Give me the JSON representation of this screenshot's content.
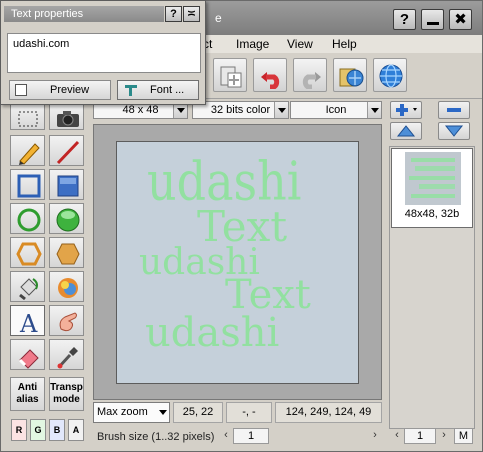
{
  "window": {
    "title_fragment": "e",
    "help_label": "?",
    "close_label": "✖"
  },
  "menu": [
    {
      "label": "ct"
    },
    {
      "label": "Image"
    },
    {
      "label": "View"
    },
    {
      "label": "Help"
    }
  ],
  "options": {
    "size": "48 x 48",
    "color_depth": "32 bits color",
    "format": "Icon"
  },
  "canvas_text": [
    "udashi",
    "Text",
    "udashi",
    "Text",
    "udashi"
  ],
  "status": {
    "zoom": "Max zoom",
    "coords": "25, 22",
    "selection": "-, -",
    "color": "124, 249, 124, 49"
  },
  "brush": {
    "label": "Brush size (1..32 pixels)",
    "value": "1"
  },
  "tools": {
    "antialias": "Anti\nalias",
    "transparent": "Transp\nmode",
    "channels": [
      "R",
      "G",
      "B",
      "A"
    ]
  },
  "right_panel": {
    "thumb_label": "48x48, 32b",
    "page_value": "1",
    "mode_label": "M"
  },
  "text_dialog": {
    "title": "Text properties",
    "text_value": "udashi.com",
    "preview_label": "Preview",
    "font_label": "Font ...",
    "help_label": "?",
    "dock_label": "≍"
  }
}
